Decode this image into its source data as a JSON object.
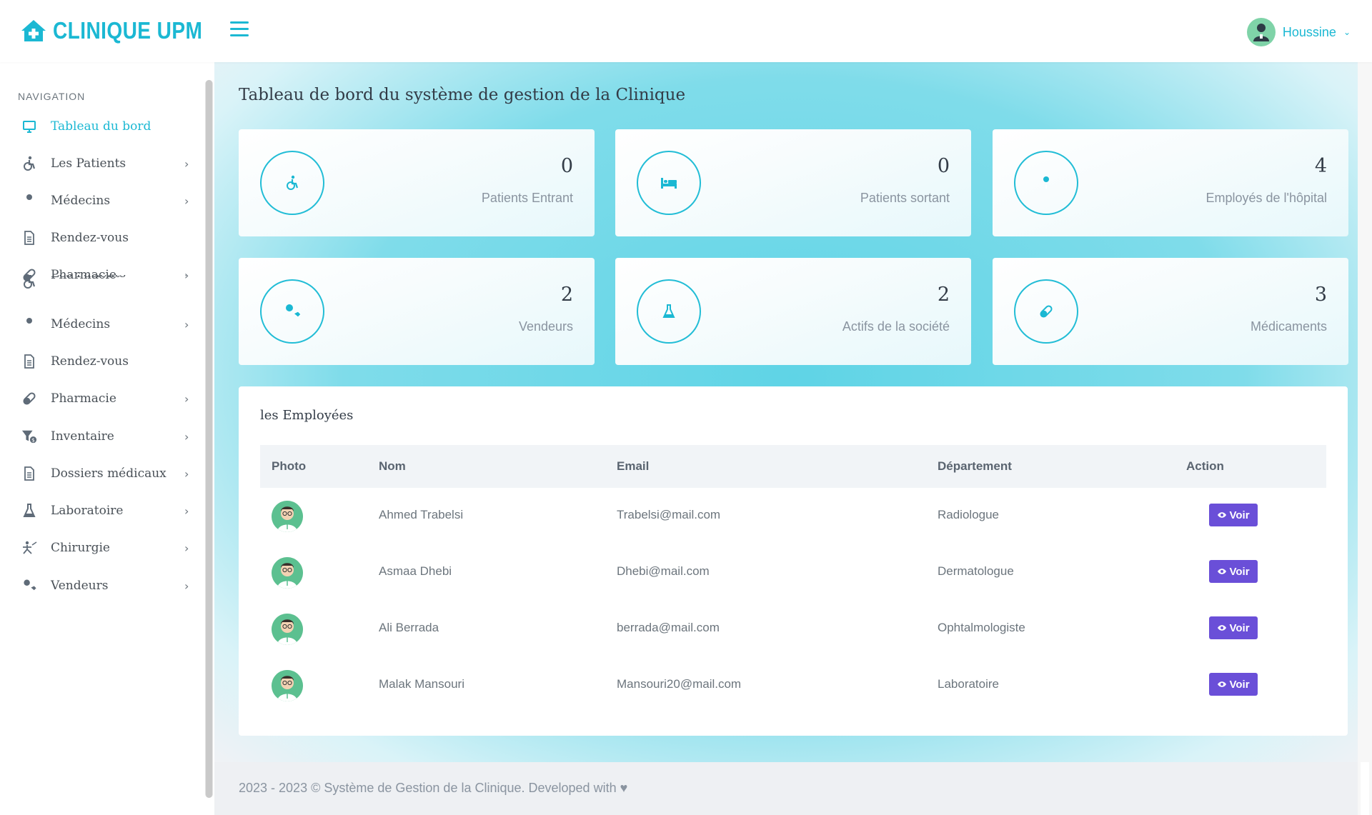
{
  "brand": {
    "name": "CLINIQUE UPM"
  },
  "user": {
    "name": "Houssine"
  },
  "sidebar": {
    "title": "NAVIGATION",
    "items": [
      {
        "label": "Tableau du bord",
        "icon": "monitor-icon",
        "active": true,
        "chevron": false
      },
      {
        "label": "Les Patients",
        "icon": "wheelchair-icon",
        "chevron": true
      },
      {
        "label": "Médecins",
        "icon": "doctor-icon",
        "chevron": true
      },
      {
        "label": "Rendez-vous",
        "icon": "file-icon",
        "chevron": false
      },
      {
        "label": "Pharmacie",
        "icon": "pill-icon",
        "chevron": true
      },
      {
        "label": "Les Patients",
        "icon": "wheelchair-icon",
        "chevron": true
      },
      {
        "label": "Médecins",
        "icon": "doctor-icon",
        "chevron": true
      },
      {
        "label": "Rendez-vous",
        "icon": "file-icon",
        "chevron": false
      },
      {
        "label": "Pharmacie",
        "icon": "pill-icon",
        "chevron": true
      },
      {
        "label": "Inventaire",
        "icon": "funnel-dollar-icon",
        "chevron": true
      },
      {
        "label": "Dossiers médicaux",
        "icon": "file-icon",
        "chevron": true
      },
      {
        "label": "Laboratoire",
        "icon": "flask-icon",
        "chevron": true
      },
      {
        "label": "Chirurgie",
        "icon": "surgery-icon",
        "chevron": true
      },
      {
        "label": "Vendeurs",
        "icon": "user-tag-icon",
        "chevron": true
      }
    ]
  },
  "page": {
    "title": "Tableau de bord du système de gestion de la Clinique"
  },
  "stats": [
    {
      "value": "0",
      "label": "Patients Entrant",
      "icon": "wheelchair-icon"
    },
    {
      "value": "0",
      "label": "Patients sortant",
      "icon": "bed-icon"
    },
    {
      "value": "4",
      "label": "Employés de l'hôpital",
      "icon": "doctor-icon"
    },
    {
      "value": "2",
      "label": "Vendeurs",
      "icon": "user-tag-icon"
    },
    {
      "value": "2",
      "label": "Actifs de la société",
      "icon": "flask-icon"
    },
    {
      "value": "3",
      "label": "Médicaments",
      "icon": "pill-icon"
    }
  ],
  "employees": {
    "title": "les Employées",
    "columns": [
      "Photo",
      "Nom",
      "Email",
      "Département",
      "Action"
    ],
    "action_label": "Voir",
    "rows": [
      {
        "name": "Ahmed Trabelsi",
        "email": "Trabelsi@mail.com",
        "department": "Radiologue"
      },
      {
        "name": "Asmaa Dhebi",
        "email": "Dhebi@mail.com",
        "department": "Dermatologue"
      },
      {
        "name": "Ali Berrada",
        "email": "berrada@mail.com",
        "department": "Ophtalmologiste"
      },
      {
        "name": "Malak Mansouri",
        "email": "Mansouri20@mail.com",
        "department": "Laboratoire"
      }
    ]
  },
  "footer": {
    "text": "2023 - 2023 © Système de Gestion de la Clinique. Developed with ♥"
  },
  "colors": {
    "accent": "#1bb8d3",
    "button": "#6a4fd8"
  }
}
